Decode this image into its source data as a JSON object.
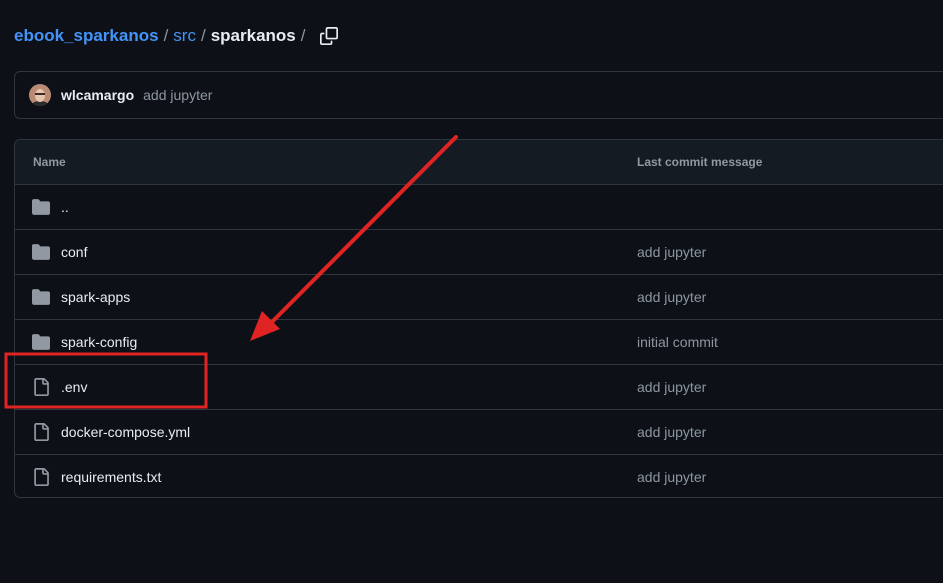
{
  "breadcrumb": {
    "repo": "ebook_sparkanos",
    "src": "src",
    "current": "sparkanos",
    "separator": "/"
  },
  "latest_commit": {
    "author": "wlcamargo",
    "message": "add jupyter"
  },
  "table": {
    "headers": {
      "name": "Name",
      "last_commit": "Last commit message"
    },
    "rows": [
      {
        "name": "..",
        "type": "folder",
        "message": ""
      },
      {
        "name": "conf",
        "type": "folder",
        "message": "add jupyter"
      },
      {
        "name": "spark-apps",
        "type": "folder",
        "message": "add jupyter"
      },
      {
        "name": "spark-config",
        "type": "folder",
        "message": "initial commit"
      },
      {
        "name": ".env",
        "type": "file",
        "message": "add jupyter"
      },
      {
        "name": "docker-compose.yml",
        "type": "file",
        "message": "add jupyter"
      },
      {
        "name": "requirements.txt",
        "type": "file",
        "message": "add jupyter"
      }
    ]
  },
  "colors": {
    "background": "#0d1117",
    "link": "#4493f8",
    "muted": "#8d96a0",
    "border": "#30363d",
    "annotation": "#e02424"
  },
  "icons": {
    "folder": "folder-icon",
    "file": "file-icon",
    "copy": "copy-icon"
  }
}
